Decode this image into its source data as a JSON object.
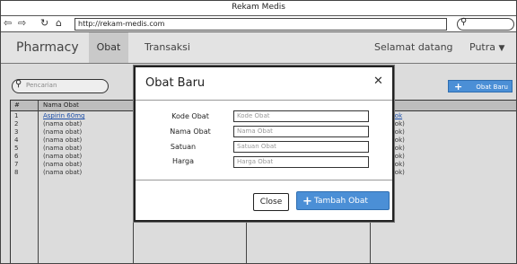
{
  "window": {
    "title": "Rekam Medis"
  },
  "browser": {
    "url": "http://rekam-medis.com"
  },
  "app": {
    "brand": "Pharmacy",
    "nav": [
      "Obat",
      "Transaksi"
    ],
    "welcome": "Selamat datang",
    "user": "Putra"
  },
  "toolbar": {
    "search_placeholder": "Pencarian",
    "add_label": "Obat Baru"
  },
  "table": {
    "headers": [
      "#",
      "Nama Obat"
    ],
    "rows": [
      {
        "num": "1",
        "name": "Aspirin 60mg",
        "stock": "bah stok"
      },
      {
        "num": "2",
        "name": "(nama obat)",
        "stock": "bah stok)"
      },
      {
        "num": "3",
        "name": "(nama obat)",
        "stock": "bah stok)"
      },
      {
        "num": "4",
        "name": "(nama obat)",
        "stock": "bah stok)"
      },
      {
        "num": "5",
        "name": "(nama obat)",
        "stock": "bah stok)"
      },
      {
        "num": "6",
        "name": "(nama obat)",
        "stock": "bah stok)"
      },
      {
        "num": "7",
        "name": "(nama obat)",
        "stock": "bah stok)"
      },
      {
        "num": "8",
        "name": "(nama obat)",
        "stock": "bah stok)"
      }
    ]
  },
  "modal": {
    "title": "Obat Baru",
    "fields": [
      {
        "label": "Kode Obat",
        "placeholder": "Kode Obat"
      },
      {
        "label": "Nama Obat",
        "placeholder": "Nama Obat"
      },
      {
        "label": "Satuan",
        "placeholder": "Satuan Obat"
      },
      {
        "label": "Harga",
        "placeholder": "Harga Obat"
      }
    ],
    "close_label": "Close",
    "submit_label": "Tambah Obat"
  },
  "colors": {
    "accent": "#4b8fd6",
    "header_bg": "#e3e3e3",
    "content_bg": "#dcdcdc"
  },
  "icons": [
    "back-arrow-icon",
    "forward-arrow-icon",
    "reload-icon",
    "home-icon",
    "search-icon",
    "plus-icon",
    "close-icon",
    "chevron-down-icon"
  ]
}
